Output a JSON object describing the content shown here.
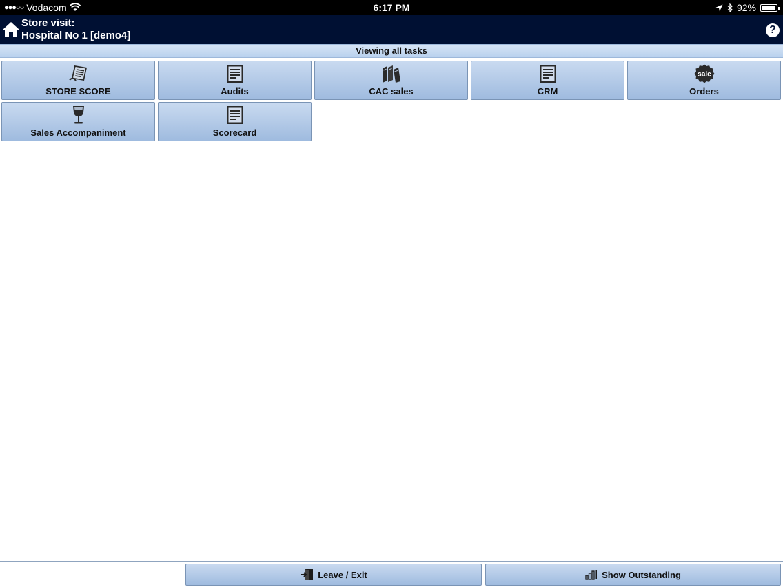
{
  "status_bar": {
    "signal_dots": "●●●○○",
    "carrier": "Vodacom",
    "time": "6:17 PM",
    "battery_text": "92%",
    "battery_level": 0.92
  },
  "header": {
    "line1": "Store visit:",
    "line2": "Hospital No 1 [demo4]",
    "help_glyph": "?"
  },
  "subheader": {
    "title": "Viewing all tasks"
  },
  "tiles": [
    {
      "label": "STORE SCORE",
      "icon": "store-score-icon"
    },
    {
      "label": "Audits",
      "icon": "document-icon"
    },
    {
      "label": "CAC sales",
      "icon": "books-icon"
    },
    {
      "label": "CRM",
      "icon": "document-icon"
    },
    {
      "label": "Orders",
      "icon": "sale-badge-icon"
    },
    {
      "label": "Sales Accompaniment",
      "icon": "wine-glass-icon"
    },
    {
      "label": "Scorecard",
      "icon": "document-icon"
    }
  ],
  "sale_badge_text": "sale",
  "bottom": {
    "leave_label": "Leave / Exit",
    "outstanding_label": "Show Outstanding"
  },
  "colors": {
    "header_bg": "#001033",
    "tile_top": "#c9daf0",
    "tile_bottom": "#9fbbdf"
  }
}
